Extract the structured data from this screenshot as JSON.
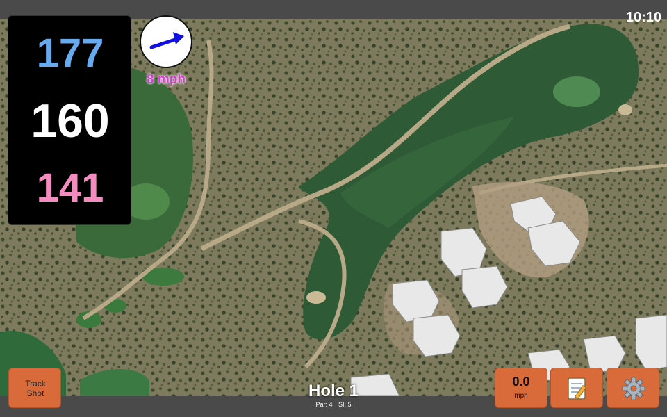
{
  "status": {
    "time": "10:10"
  },
  "distances": {
    "back": "177",
    "middle": "160",
    "front": "141"
  },
  "wind": {
    "speed": "8 mph",
    "icon": "arrow-right-up-icon",
    "arrow_color": "#1010e0"
  },
  "hole": {
    "title": "Hole 1",
    "par": "Par: 4",
    "stroke_index": "SI: 5"
  },
  "buttons": {
    "track_shot": "Track Shot",
    "speed_value": "0.0",
    "speed_unit": "mph",
    "notes_icon": "notepad-icon",
    "settings_icon": "gear-icon"
  },
  "colors": {
    "button": "#d96a3a",
    "back_distance": "#68aaf0",
    "middle_distance": "#ffffff",
    "front_distance": "#f48cc0",
    "wind_text": "#d33fcf"
  }
}
